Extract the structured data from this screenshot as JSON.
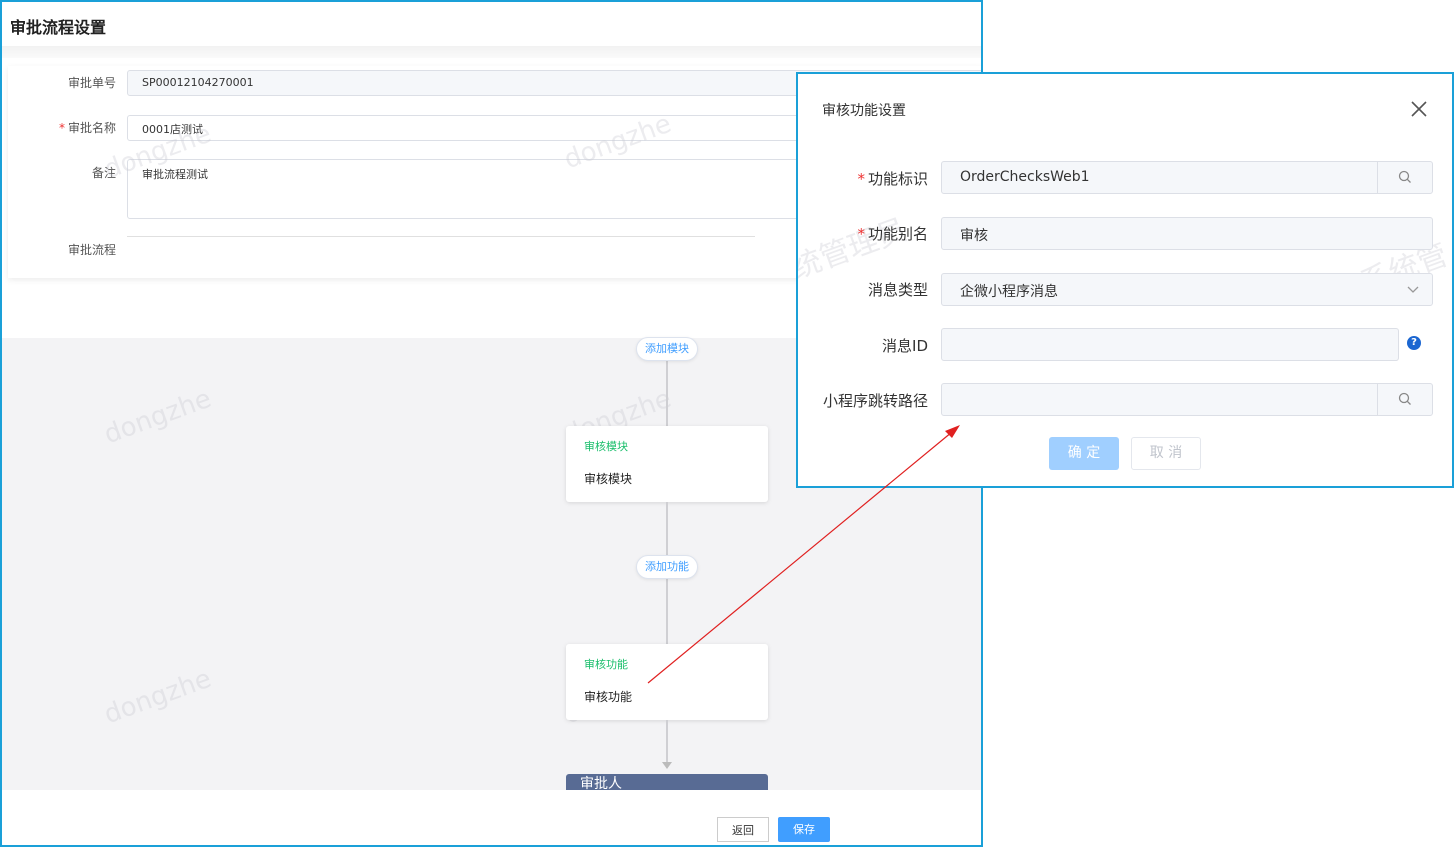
{
  "page": {
    "title": "审批流程设置"
  },
  "form": {
    "number_label": "审批单号",
    "number_value": "SP00012104270001",
    "name_label": "审批名称",
    "name_value": "0001店测试",
    "remark_label": "备注",
    "remark_value": "审批流程测试",
    "flow_label": "审批流程"
  },
  "flow": {
    "add_module_label": "添加模块",
    "module_card": {
      "type": "审核模块",
      "name": "审核模块"
    },
    "add_function_label": "添加功能",
    "function_card": {
      "type": "审核功能",
      "name": "审核功能"
    },
    "approver_label": "审批人"
  },
  "footer": {
    "back_label": "返回",
    "save_label": "保存"
  },
  "watermark": "dongzhe",
  "dialog": {
    "title": "审核功能设置",
    "fields": {
      "func_id_label": "功能标识",
      "func_id_value": "OrderChecksWeb1",
      "func_alias_label": "功能别名",
      "func_alias_value": "审核",
      "msg_type_label": "消息类型",
      "msg_type_value": "企微小程序消息",
      "msg_id_label": "消息ID",
      "msg_id_value": "",
      "path_label": "小程序跳转路径",
      "path_value": ""
    },
    "ok_label": "确 定",
    "cancel_label": "取 消"
  },
  "colors": {
    "accent": "#409eff",
    "frame_border": "#1aa0d8",
    "node_type_green": "#19be6b",
    "approver_header": "#586b94",
    "annotation_arrow": "#e02020"
  },
  "icons": [
    "search-icon",
    "close-icon",
    "chevron-down-icon",
    "help-icon"
  ]
}
